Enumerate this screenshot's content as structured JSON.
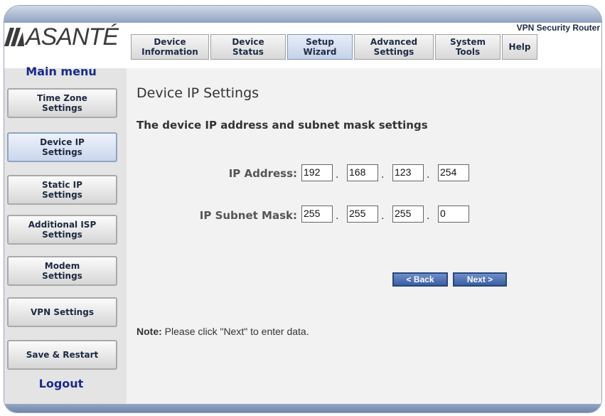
{
  "header": {
    "product_name": "VPN Security Router",
    "logo_text": "ASANTÉ"
  },
  "tabs": [
    {
      "label": "Device\nInformation",
      "active": false
    },
    {
      "label": "Device\nStatus",
      "active": false
    },
    {
      "label": "Setup\nWizard",
      "active": true
    },
    {
      "label": "Advanced\nSettings",
      "active": false
    },
    {
      "label": "System\nTools",
      "active": false
    },
    {
      "label": "Help",
      "active": false
    }
  ],
  "sidebar": {
    "title": "Main menu",
    "items": [
      {
        "label": "Time Zone\nSettings",
        "active": false
      },
      {
        "label": "Device IP\nSettings",
        "active": true
      },
      {
        "label": "Static IP\nSettings",
        "active": false
      },
      {
        "label": "Additional ISP\nSettings",
        "active": false
      },
      {
        "label": "Modem\nSettings",
        "active": false
      },
      {
        "label": "VPN Settings",
        "active": false
      },
      {
        "label": "Save & Restart",
        "active": false
      }
    ],
    "logout": "Logout"
  },
  "main": {
    "title": "Device IP Settings",
    "subtitle": "The device IP address and subnet mask settings",
    "ip_address": {
      "label": "IP Address:",
      "octets": [
        "192",
        "168",
        "123",
        "254"
      ]
    },
    "subnet_mask": {
      "label": "IP Subnet Mask:",
      "octets": [
        "255",
        "255",
        "255",
        "0"
      ]
    },
    "back_label": "< Back",
    "next_label": "Next >",
    "note_label": "Note:",
    "note_text": " Please click \"Next\" to enter data."
  },
  "colors": {
    "accent_blue": "#3b5ea3",
    "menu_text": "#1a2a8a"
  }
}
